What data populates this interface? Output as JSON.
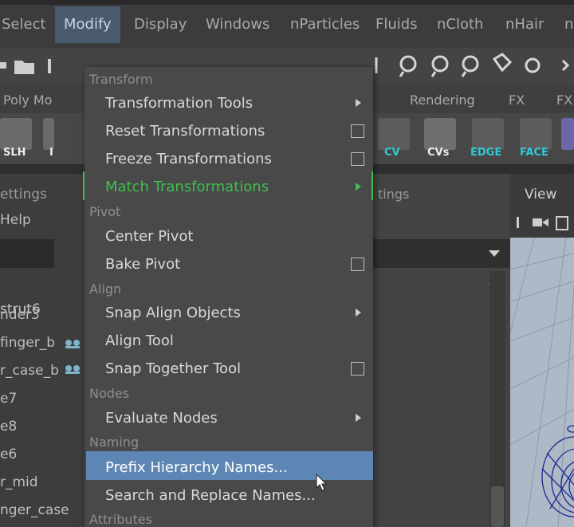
{
  "menubar": {
    "items": [
      "Select",
      "Modify",
      "Display",
      "Windows",
      "nParticles",
      "Fluids",
      "nCloth",
      "nHair",
      "n"
    ],
    "active": "Modify"
  },
  "shelf_tabs": [
    "Poly Mo",
    "Rendering",
    "FX",
    "FX"
  ],
  "shelf_labels": [
    "SLH",
    "I",
    "CV",
    "CVs",
    "EDGE",
    "FACE"
  ],
  "outliner": {
    "header1": "ettings",
    "header2": "Help",
    "rows": [
      "strut6",
      "nder3",
      "finger_b",
      "r_case_b",
      "e7",
      "e8",
      "e6",
      "r_mid",
      "nger_case"
    ]
  },
  "mid_panel": {
    "header": "tings"
  },
  "viewport": {
    "view_label": "View"
  },
  "menu": {
    "sections": {
      "transform": "Transform",
      "pivot": "Pivot",
      "align": "Align",
      "nodes": "Nodes",
      "naming": "Naming",
      "attributes": "Attributes"
    },
    "items": {
      "transformation_tools": "Transformation Tools",
      "reset_transformations": "Reset Transformations",
      "freeze_transformations": "Freeze Transformations",
      "match_transformations": "Match Transformations",
      "center_pivot": "Center Pivot",
      "bake_pivot": "Bake Pivot",
      "snap_align_objects": "Snap Align Objects",
      "align_tool": "Align Tool",
      "snap_together_tool": "Snap Together Tool",
      "evaluate_nodes": "Evaluate Nodes",
      "prefix_hierarchy_names": "Prefix Hierarchy Names...",
      "search_replace_names": "Search and Replace Names..."
    }
  },
  "colors": {
    "highlight": "#5d86b4",
    "match_green": "#3fbf4f",
    "menu_bg": "#494949",
    "cyan_label": "#33c7d6"
  }
}
